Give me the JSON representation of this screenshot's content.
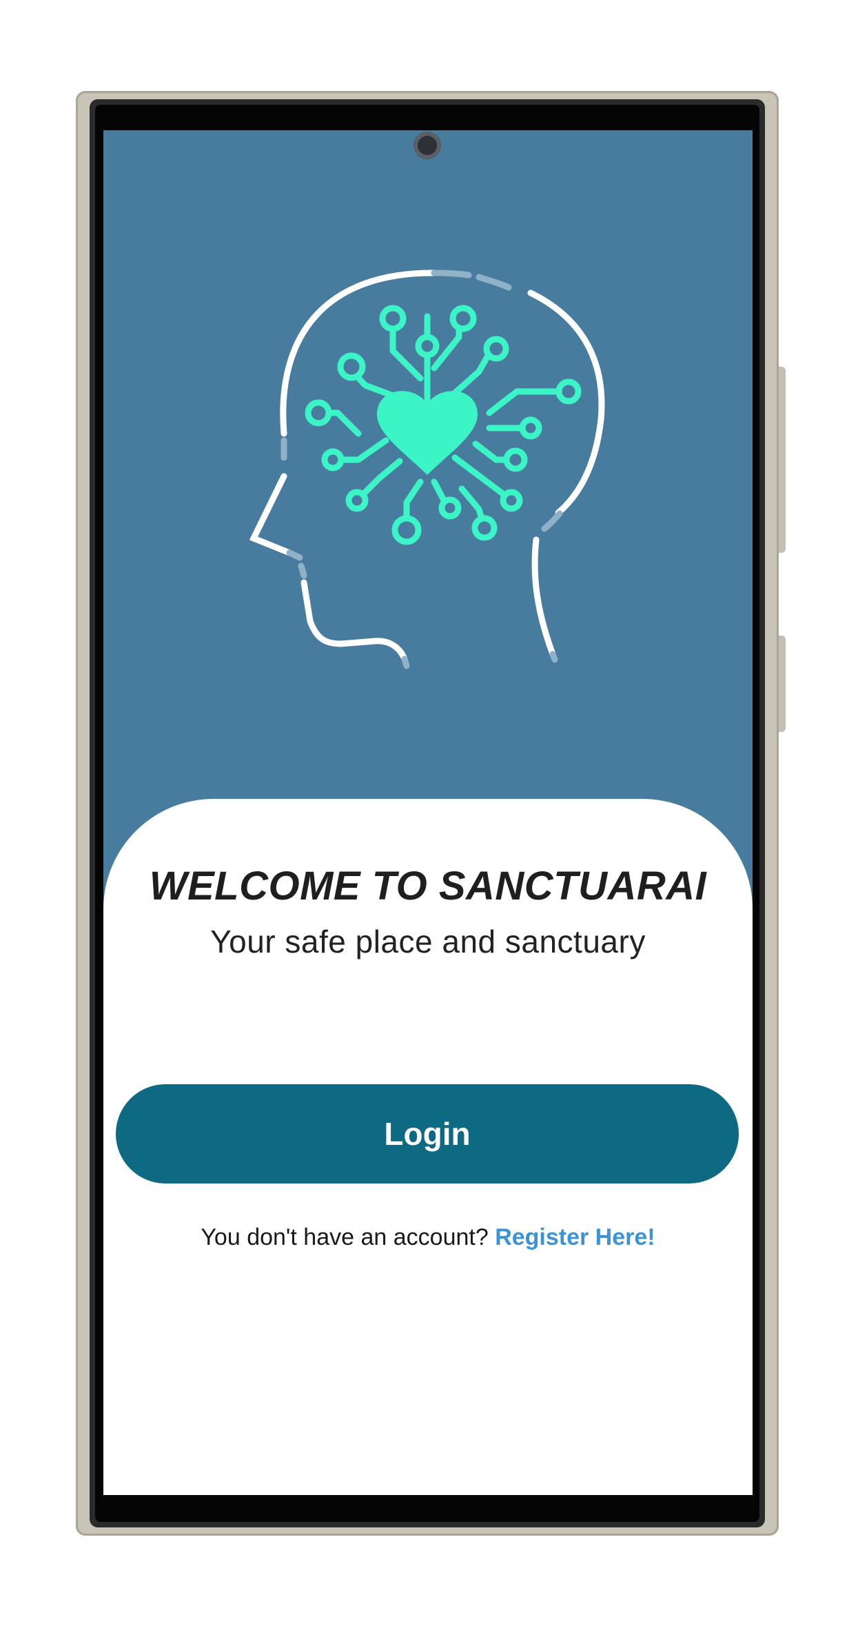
{
  "app": {
    "accent_color": "#0e6982",
    "background_color": "#477c9e",
    "link_color": "#3a94d6",
    "illustration_color": "#3cf5c6",
    "logo_icon": "brain-heart-circuit-head-icon"
  },
  "welcome": {
    "title": "WELCOME TO SANCTUARAI",
    "subtitle": "Your safe place and sanctuary"
  },
  "actions": {
    "login_label": "Login",
    "register_prompt": "You don't have an account? ",
    "register_link": "Register Here!"
  }
}
